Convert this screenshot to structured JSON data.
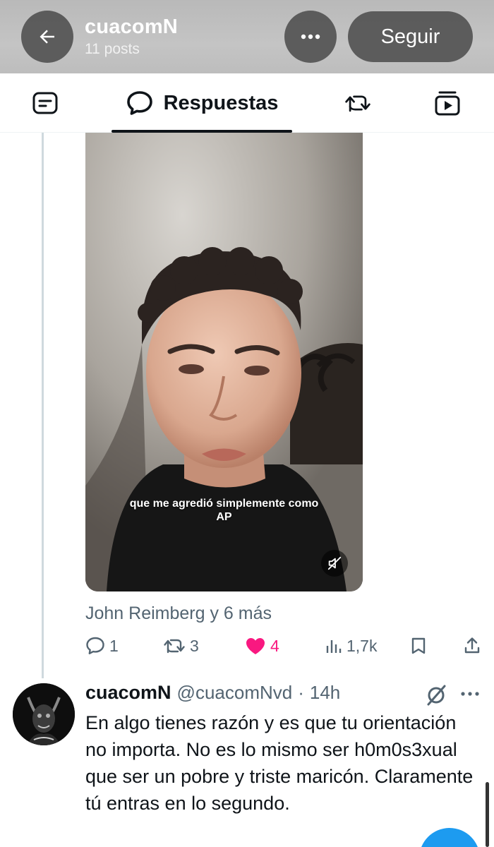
{
  "header": {
    "title": "cuacomN",
    "subtitle": "11 posts",
    "follow_label": "Seguir",
    "back_icon": "arrow-left-icon",
    "more_icon": "more-horizontal-icon"
  },
  "tabs": {
    "active_label": "Respuestas",
    "items": [
      {
        "name": "posts",
        "icon": "posts-icon"
      },
      {
        "name": "replies",
        "icon": "speech-bubble-icon",
        "label": "Respuestas",
        "active": true
      },
      {
        "name": "reposts",
        "icon": "repost-icon"
      },
      {
        "name": "media",
        "icon": "media-icon"
      }
    ]
  },
  "video": {
    "caption_line1": "que me agredió simplemente como",
    "caption_line2": "AP",
    "muted": true
  },
  "liked_by": "John Reimberg y 6 más",
  "actions": {
    "replies": "1",
    "reposts": "3",
    "likes": "4",
    "views": "1,7k",
    "liked": true
  },
  "reply": {
    "name": "cuacomN",
    "handle": "@cuacomNvd",
    "separator": "·",
    "time": "14h",
    "text": "En algo tienes razón y es que tu orientación no importa. No es lo mismo ser h0m0s3xual que ser un pobre y triste maricón. Claramente tú entras en lo segundo."
  },
  "colors": {
    "accent": "#1d9bf0",
    "like": "#f91880",
    "secondary_text": "#536471",
    "primary_text": "#0f1419"
  }
}
